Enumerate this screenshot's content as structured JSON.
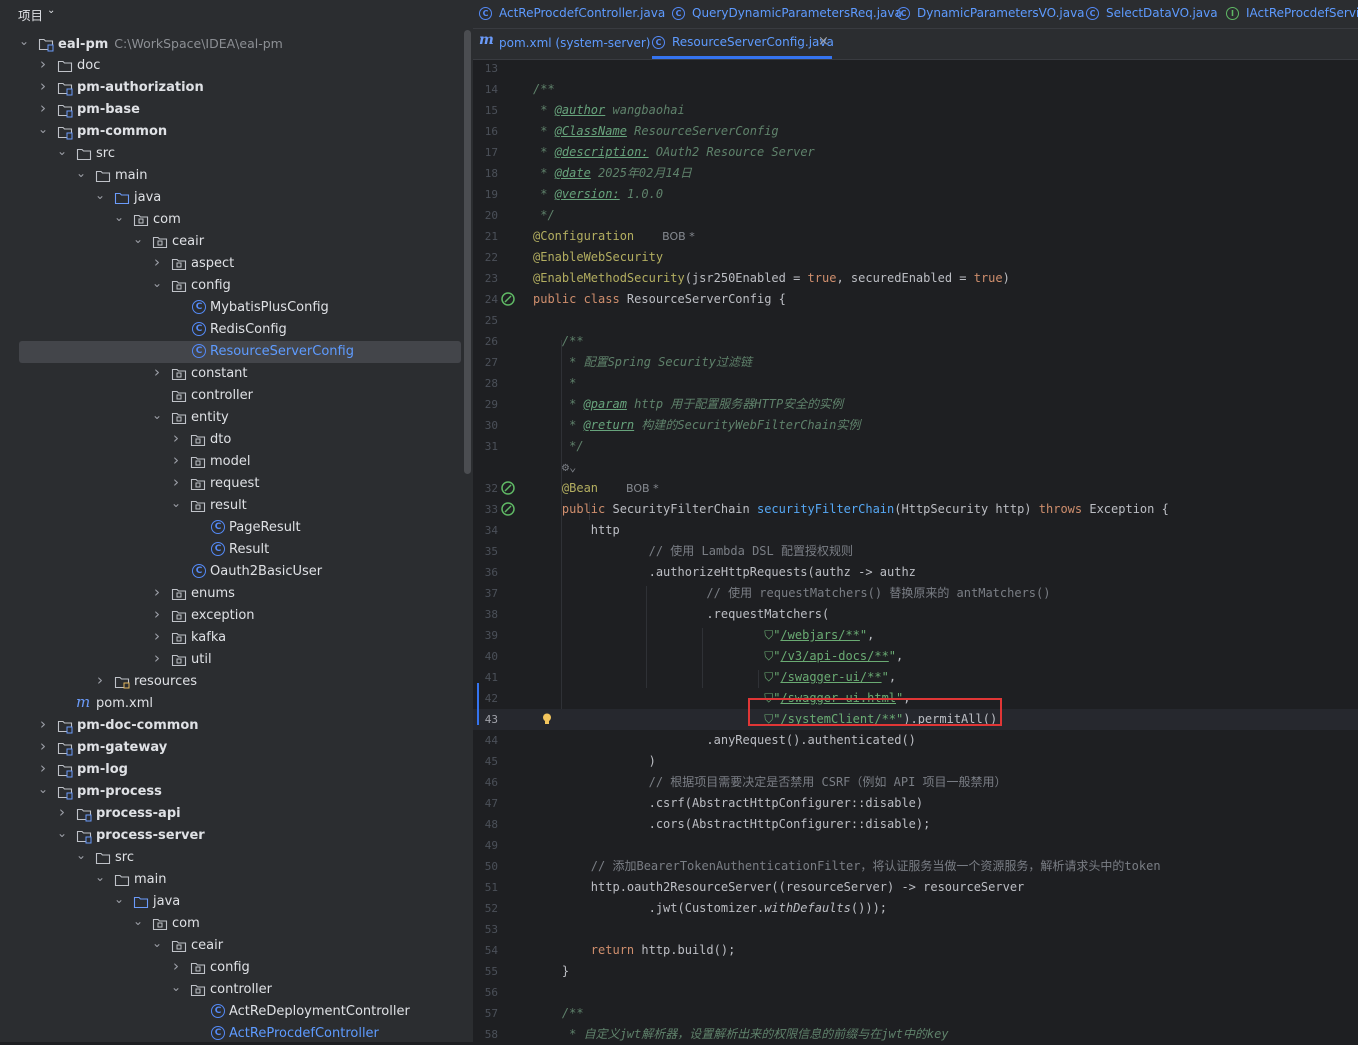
{
  "project_panel": {
    "title": "项目",
    "tree": [
      {
        "depth": 0,
        "arrow": "down",
        "icon": "module",
        "label": "eal-pm",
        "bold": true,
        "path": "C:\\WorkSpace\\IDEA\\eal-pm"
      },
      {
        "depth": 1,
        "arrow": "right",
        "icon": "folder",
        "label": "doc"
      },
      {
        "depth": 1,
        "arrow": "right",
        "icon": "module",
        "label": "pm-authorization",
        "bold": true
      },
      {
        "depth": 1,
        "arrow": "right",
        "icon": "module",
        "label": "pm-base",
        "bold": true
      },
      {
        "depth": 1,
        "arrow": "down",
        "icon": "module",
        "label": "pm-common",
        "bold": true
      },
      {
        "depth": 2,
        "arrow": "down",
        "icon": "folder",
        "label": "src"
      },
      {
        "depth": 3,
        "arrow": "down",
        "icon": "folder",
        "label": "main"
      },
      {
        "depth": 4,
        "arrow": "down",
        "icon": "src-folder",
        "label": "java"
      },
      {
        "depth": 5,
        "arrow": "down",
        "icon": "package",
        "label": "com"
      },
      {
        "depth": 6,
        "arrow": "down",
        "icon": "package",
        "label": "ceair"
      },
      {
        "depth": 7,
        "arrow": "right",
        "icon": "package",
        "label": "aspect"
      },
      {
        "depth": 7,
        "arrow": "down",
        "icon": "package",
        "label": "config"
      },
      {
        "depth": 8,
        "arrow": "none",
        "icon": "class",
        "label": "MybatisPlusConfig"
      },
      {
        "depth": 8,
        "arrow": "none",
        "icon": "class",
        "label": "RedisConfig"
      },
      {
        "depth": 8,
        "arrow": "none",
        "icon": "class",
        "label": "ResourceServerConfig",
        "selected": true
      },
      {
        "depth": 7,
        "arrow": "right",
        "icon": "package",
        "label": "constant"
      },
      {
        "depth": 7,
        "arrow": "none",
        "icon": "package",
        "label": "controller"
      },
      {
        "depth": 7,
        "arrow": "down",
        "icon": "package",
        "label": "entity"
      },
      {
        "depth": 8,
        "arrow": "right",
        "icon": "package",
        "label": "dto"
      },
      {
        "depth": 8,
        "arrow": "right",
        "icon": "package",
        "label": "model"
      },
      {
        "depth": 8,
        "arrow": "right",
        "icon": "package",
        "label": "request"
      },
      {
        "depth": 8,
        "arrow": "down",
        "icon": "package",
        "label": "result"
      },
      {
        "depth": 9,
        "arrow": "none",
        "icon": "class",
        "label": "PageResult"
      },
      {
        "depth": 9,
        "arrow": "none",
        "icon": "class",
        "label": "Result"
      },
      {
        "depth": 8,
        "arrow": "none",
        "icon": "class",
        "label": "Oauth2BasicUser"
      },
      {
        "depth": 7,
        "arrow": "right",
        "icon": "package",
        "label": "enums"
      },
      {
        "depth": 7,
        "arrow": "right",
        "icon": "package",
        "label": "exception"
      },
      {
        "depth": 7,
        "arrow": "right",
        "icon": "package",
        "label": "kafka"
      },
      {
        "depth": 7,
        "arrow": "right",
        "icon": "package",
        "label": "util"
      },
      {
        "depth": 4,
        "arrow": "right",
        "icon": "res-folder",
        "label": "resources"
      },
      {
        "depth": 2,
        "arrow": "none",
        "icon": "maven",
        "label": "pom.xml"
      },
      {
        "depth": 1,
        "arrow": "right",
        "icon": "module",
        "label": "pm-doc-common",
        "bold": true
      },
      {
        "depth": 1,
        "arrow": "right",
        "icon": "module",
        "label": "pm-gateway",
        "bold": true
      },
      {
        "depth": 1,
        "arrow": "right",
        "icon": "module",
        "label": "pm-log",
        "bold": true
      },
      {
        "depth": 1,
        "arrow": "down",
        "icon": "module",
        "label": "pm-process",
        "bold": true
      },
      {
        "depth": 2,
        "arrow": "right",
        "icon": "module",
        "label": "process-api",
        "bold": true
      },
      {
        "depth": 2,
        "arrow": "down",
        "icon": "module",
        "label": "process-server",
        "bold": true
      },
      {
        "depth": 3,
        "arrow": "down",
        "icon": "folder",
        "label": "src"
      },
      {
        "depth": 4,
        "arrow": "down",
        "icon": "folder",
        "label": "main"
      },
      {
        "depth": 5,
        "arrow": "down",
        "icon": "src-folder",
        "label": "java"
      },
      {
        "depth": 6,
        "arrow": "down",
        "icon": "package",
        "label": "com"
      },
      {
        "depth": 7,
        "arrow": "down",
        "icon": "package",
        "label": "ceair"
      },
      {
        "depth": 8,
        "arrow": "right",
        "icon": "package",
        "label": "config"
      },
      {
        "depth": 8,
        "arrow": "down",
        "icon": "package",
        "label": "controller"
      },
      {
        "depth": 9,
        "arrow": "none",
        "icon": "class",
        "label": "ActReDeploymentController"
      },
      {
        "depth": 9,
        "arrow": "none",
        "icon": "class",
        "label": "ActReProcdefController",
        "link": true
      }
    ]
  },
  "editor": {
    "tabs_row_1": [
      {
        "icon": "class",
        "label": "ActReProcdefController.java"
      },
      {
        "icon": "class",
        "label": "QueryDynamicParametersReq.java"
      },
      {
        "icon": "class",
        "label": "DynamicParametersVO.java"
      },
      {
        "icon": "class",
        "label": "SelectDataVO.java"
      },
      {
        "icon": "interface",
        "label": "IActReProcdefService.java"
      }
    ],
    "tabs_row_2": [
      {
        "icon": "maven",
        "label": "pom.xml (system-server)",
        "active": false
      },
      {
        "icon": "class",
        "label": "ResourceServerConfig.java",
        "active": true,
        "closable": true
      }
    ],
    "close_glyph": "×",
    "current_line": 43,
    "lines": [
      {
        "n": 13,
        "t": []
      },
      {
        "n": 14,
        "t": [
          [
            "c-com",
            "/**"
          ]
        ]
      },
      {
        "n": 15,
        "t": [
          [
            "c-com",
            " * "
          ],
          [
            "c-tag",
            "@author"
          ],
          [
            "c-com",
            " wangbaohai"
          ]
        ]
      },
      {
        "n": 16,
        "t": [
          [
            "c-com",
            " * "
          ],
          [
            "c-tag",
            "@ClassName"
          ],
          [
            "c-com",
            " ResourceServerConfig"
          ]
        ]
      },
      {
        "n": 17,
        "t": [
          [
            "c-com",
            " * "
          ],
          [
            "c-tag",
            "@description:"
          ],
          [
            "c-com",
            " OAuth2 Resource Server"
          ]
        ]
      },
      {
        "n": 18,
        "t": [
          [
            "c-com",
            " * "
          ],
          [
            "c-tag",
            "@date"
          ],
          [
            "c-com",
            " 2025年02月14日"
          ]
        ]
      },
      {
        "n": 19,
        "t": [
          [
            "c-com",
            " * "
          ],
          [
            "c-tag",
            "@version:"
          ],
          [
            "c-com",
            " 1.0.0"
          ]
        ]
      },
      {
        "n": 20,
        "t": [
          [
            "c-com",
            " */"
          ]
        ]
      },
      {
        "n": 21,
        "t": [
          [
            "c-ann",
            "@Configuration"
          ]
        ],
        "hint": "BOB *"
      },
      {
        "n": 22,
        "t": [
          [
            "c-ann",
            "@EnableWebSecurity"
          ]
        ]
      },
      {
        "n": 23,
        "t": [
          [
            "c-ann",
            "@EnableMethodSecurity"
          ],
          [
            "c-plain",
            "(jsr250Enabled = "
          ],
          [
            "c-kw",
            "true"
          ],
          [
            "c-plain",
            ", securedEnabled = "
          ],
          [
            "c-kw",
            "true"
          ],
          [
            "c-plain",
            ")"
          ]
        ]
      },
      {
        "n": 24,
        "t": [
          [
            "c-kw",
            "public class "
          ],
          [
            "c-plain",
            "ResourceServerConfig {"
          ]
        ],
        "gutter": "bean"
      },
      {
        "n": 25,
        "t": []
      },
      {
        "n": 26,
        "t": [
          [
            "c-com",
            "    /**"
          ]
        ]
      },
      {
        "n": 27,
        "t": [
          [
            "c-com",
            "     * 配置Spring Security过滤链"
          ]
        ]
      },
      {
        "n": 28,
        "t": [
          [
            "c-com",
            "     *"
          ]
        ]
      },
      {
        "n": 29,
        "t": [
          [
            "c-com",
            "     * "
          ],
          [
            "c-tag",
            "@param"
          ],
          [
            "c-com",
            " http 用于配置服务器HTTP安全的实例"
          ]
        ]
      },
      {
        "n": 30,
        "t": [
          [
            "c-com",
            "     * "
          ],
          [
            "c-tag",
            "@return"
          ],
          [
            "c-com",
            " 构建的SecurityWebFilterChain实例"
          ]
        ]
      },
      {
        "n": 31,
        "t": [
          [
            "c-com",
            "     */"
          ]
        ]
      },
      {
        "n": null,
        "t": [
          [
            "c-gray",
            "    ⚙⌄"
          ]
        ]
      },
      {
        "n": 32,
        "t": [
          [
            "c-ann",
            "    @Bean"
          ]
        ],
        "hint": "BOB *",
        "gutter": "bean"
      },
      {
        "n": 33,
        "t": [
          [
            "c-kw",
            "    public "
          ],
          [
            "c-plain",
            "SecurityFilterChain "
          ],
          [
            "c-fn",
            "securityFilterChain"
          ],
          [
            "c-plain",
            "(HttpSecurity http) "
          ],
          [
            "c-kw",
            "throws "
          ],
          [
            "c-plain",
            "Exception {"
          ]
        ],
        "gutter": "bean"
      },
      {
        "n": 34,
        "t": [
          [
            "c-plain",
            "        http"
          ]
        ]
      },
      {
        "n": 35,
        "t": [
          [
            "c-gray",
            "                // 使用 Lambda DSL 配置授权规则"
          ]
        ]
      },
      {
        "n": 36,
        "t": [
          [
            "c-plain",
            "                .authorizeHttpRequests(authz -> authz"
          ]
        ]
      },
      {
        "n": 37,
        "t": [
          [
            "c-gray",
            "                        // 使用 requestMatchers() 替换原来的 antMatchers()"
          ]
        ]
      },
      {
        "n": 38,
        "t": [
          [
            "c-plain",
            "                        .requestMatchers("
          ]
        ]
      },
      {
        "n": 39,
        "t": [
          [
            "c-plain",
            "                                "
          ],
          [
            "c-str",
            "⛉\""
          ],
          [
            "c-link",
            "/webjars/**"
          ],
          [
            "c-str",
            "\""
          ],
          [
            "c-plain",
            ","
          ]
        ]
      },
      {
        "n": 40,
        "t": [
          [
            "c-plain",
            "                                "
          ],
          [
            "c-str",
            "⛉\""
          ],
          [
            "c-link",
            "/v3/api-docs/**"
          ],
          [
            "c-str",
            "\""
          ],
          [
            "c-plain",
            ","
          ]
        ]
      },
      {
        "n": 41,
        "t": [
          [
            "c-plain",
            "                                "
          ],
          [
            "c-str",
            "⛉\""
          ],
          [
            "c-link",
            "/swagger-ui/**"
          ],
          [
            "c-str",
            "\""
          ],
          [
            "c-plain",
            ","
          ]
        ]
      },
      {
        "n": 42,
        "t": [
          [
            "c-plain",
            "                                "
          ],
          [
            "c-str",
            "⛉\""
          ],
          [
            "c-link",
            "/swagger-ui.html"
          ],
          [
            "c-str",
            "\""
          ],
          [
            "c-plain",
            ","
          ]
        ]
      },
      {
        "n": 43,
        "t": [
          [
            "c-plain",
            "                                "
          ],
          [
            "c-str",
            "⛉\""
          ],
          [
            "c-link",
            "/systemClient/**"
          ],
          [
            "c-str",
            "\""
          ],
          [
            "c-plain",
            ").permitAll()"
          ]
        ],
        "gutter": "bulb"
      },
      {
        "n": 44,
        "t": [
          [
            "c-plain",
            "                        .anyRequest().authenticated()"
          ]
        ]
      },
      {
        "n": 45,
        "t": [
          [
            "c-plain",
            "                )"
          ]
        ]
      },
      {
        "n": 46,
        "t": [
          [
            "c-gray",
            "                // 根据项目需要决定是否禁用 CSRF（例如 API 项目一般禁用）"
          ]
        ]
      },
      {
        "n": 47,
        "t": [
          [
            "c-plain",
            "                .csrf(AbstractHttpConfigurer::disable)"
          ]
        ]
      },
      {
        "n": 48,
        "t": [
          [
            "c-plain",
            "                .cors(AbstractHttpConfigurer::disable);"
          ]
        ]
      },
      {
        "n": 49,
        "t": []
      },
      {
        "n": 50,
        "t": [
          [
            "c-gray",
            "        // 添加BearerTokenAuthenticationFilter，将认证服务当做一个资源服务，解析请求头中的token"
          ]
        ]
      },
      {
        "n": 51,
        "t": [
          [
            "c-plain",
            "        http.oauth2ResourceServer((resourceServer) -> resourceServer"
          ]
        ]
      },
      {
        "n": 52,
        "t": [
          [
            "c-plain",
            "                .jwt(Customizer."
          ],
          [
            "c-plain c-ital",
            "withDefaults"
          ],
          [
            "c-plain",
            "()));"
          ]
        ]
      },
      {
        "n": 53,
        "t": []
      },
      {
        "n": 54,
        "t": [
          [
            "c-kw",
            "        return "
          ],
          [
            "c-plain",
            "http.build();"
          ]
        ]
      },
      {
        "n": 55,
        "t": [
          [
            "c-plain",
            "    }"
          ]
        ]
      },
      {
        "n": 56,
        "t": []
      },
      {
        "n": 57,
        "t": [
          [
            "c-com",
            "    /**"
          ]
        ]
      },
      {
        "n": 58,
        "t": [
          [
            "c-com",
            "     * 自定义jwt解析器，设置解析出来的权限信息的前缀与在jwt中的key"
          ]
        ]
      }
    ]
  },
  "colors": {
    "selection": "#43454a",
    "highlight_box": "#e03636",
    "accent": "#3574f0"
  }
}
